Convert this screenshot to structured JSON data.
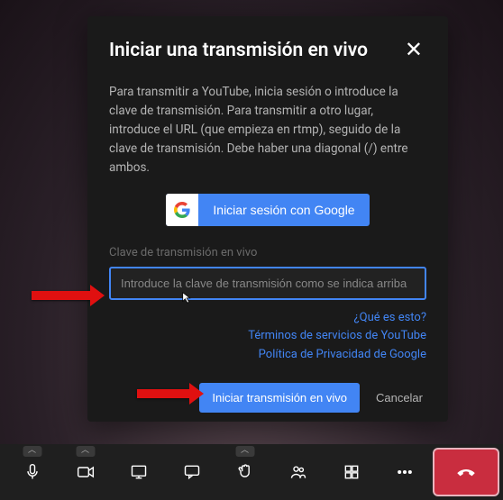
{
  "modal": {
    "title": "Iniciar una transmisión en vivo",
    "description": "Para transmitir a YouTube, inicia sesión o introduce la clave de transmisión. Para transmitir a otro lugar, introduce el URL (que empieza en rtmp), seguido de la clave de transmisión. Debe haber una diagonal (/) entre ambos.",
    "google_signin": "Iniciar sesión con Google",
    "field_label": "Clave de transmisión en vivo",
    "input_placeholder": "Introduce la clave de transmisión como se indica arriba",
    "input_value": "",
    "links": {
      "what_is_this": "¿Qué es esto?",
      "youtube_tos": "Términos de servicios de YouTube",
      "google_privacy": "Política de Privacidad de Google"
    },
    "submit": "Iniciar transmisión en vivo",
    "cancel": "Cancelar"
  },
  "colors": {
    "accent": "#4285f4",
    "hangup": "#c92d3f",
    "arrow": "#e01010"
  },
  "toolbar": {
    "mic": "microphone",
    "camera": "camera",
    "screen": "screen-share",
    "chat": "chat",
    "raise_hand": "raise-hand",
    "participants": "participants",
    "apps": "apps",
    "more": "more-options",
    "hangup": "hang-up"
  }
}
